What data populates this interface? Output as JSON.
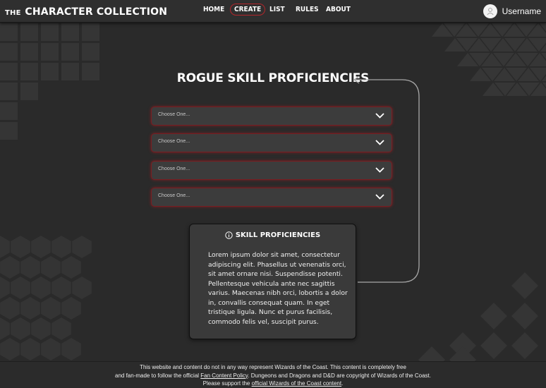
{
  "header": {
    "brand_prefix": "THE",
    "brand_main": "CHARACTER COLLECTION",
    "nav": [
      {
        "label": "HOME"
      },
      {
        "label": "CREATE"
      },
      {
        "label": "LIST"
      },
      {
        "label": "RULES"
      },
      {
        "label": "ABOUT"
      }
    ],
    "active_nav": "CREATE",
    "username": "Username"
  },
  "main": {
    "title": "ROGUE SKILL PROFICIENCIES",
    "selects": [
      {
        "placeholder": "Choose One..."
      },
      {
        "placeholder": "Choose One..."
      },
      {
        "placeholder": "Choose One..."
      },
      {
        "placeholder": "Choose One..."
      }
    ],
    "info_card": {
      "title": "SKILL PROFICIENCIES",
      "body": "Lorem ipsum dolor sit amet, consectetur adipiscing elit. Phasellus ut  venenatis orci, sit amet ornare nisi. Suspendisse potenti. Pellentesque  vehicula ante nec sagittis varius. Maecenas nibh orci, lobortis a dolor in, convallis consequat quam. In eget tristique ligula. Nunc et purus  facilisis, commodo felis vel, suscipit purus."
    }
  },
  "footer": {
    "line1": "This website and content do not in any way represent Wizards of the Coast. This content is completely free",
    "line2_pre": "and fan-made to follow the official ",
    "line2_link": "Fan Content Policy",
    "line2_post": ". Dungeons and Dragons and D&D are copyright of Wizards of the Coast.",
    "line3_pre": "Please support the ",
    "line3_link": "official Wizards of the Coast content",
    "line3_post": "."
  },
  "colors": {
    "background": "#2a2a2a",
    "accent_red": "#b3262b",
    "card": "#3a3a3a"
  },
  "icons": [
    "user-icon",
    "chevron-down-icon",
    "info-icon",
    "curved-arrow-icon"
  ]
}
